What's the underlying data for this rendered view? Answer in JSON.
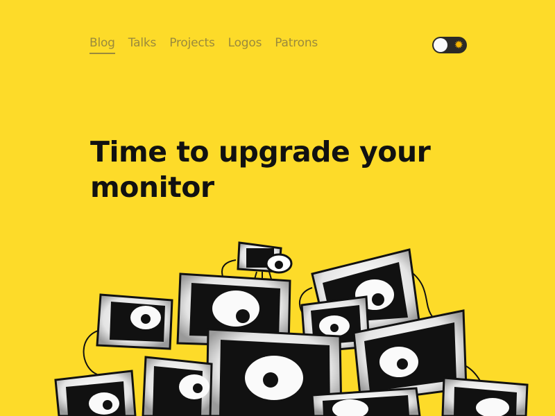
{
  "nav": {
    "items": [
      {
        "label": "Blog",
        "active": true
      },
      {
        "label": "Talks",
        "active": false
      },
      {
        "label": "Projects",
        "active": false
      },
      {
        "label": "Logos",
        "active": false
      },
      {
        "label": "Patrons",
        "active": false
      }
    ]
  },
  "theme_toggle": {
    "icon": "sun-icon",
    "state": "light"
  },
  "article": {
    "title": "Time to upgrade your monitor"
  },
  "colors": {
    "background": "#fddb29",
    "nav_text": "#9a8a3c",
    "title_text": "#111111",
    "toggle_bg": "#2b2a27"
  }
}
